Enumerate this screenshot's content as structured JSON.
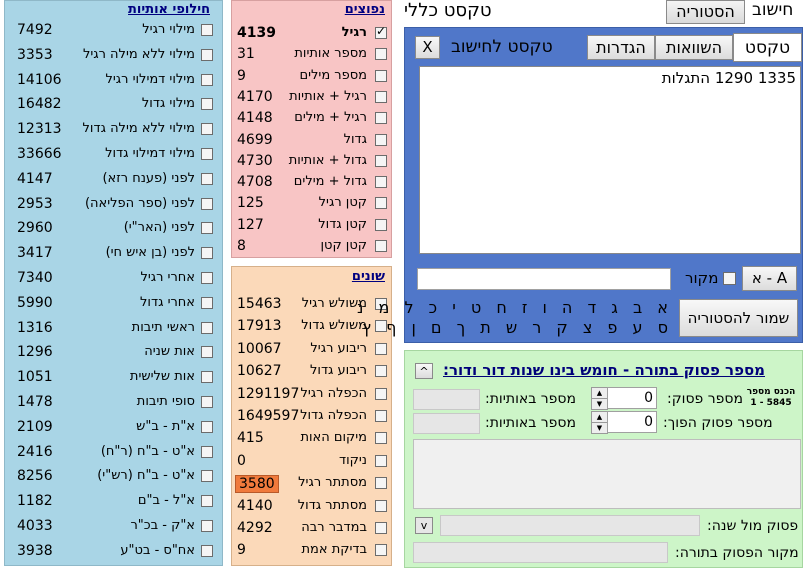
{
  "window": {
    "tab_calc": "חישוב",
    "tab_history": "הסטוריה",
    "general_text": "טקסט כללי"
  },
  "letter_swaps": {
    "title": "חילופי אותיות",
    "rows": [
      {
        "value": "7492",
        "label": "מילוי רגיל"
      },
      {
        "value": "3353",
        "label": "מילוי ללא מילה רגיל"
      },
      {
        "value": "14106",
        "label": "מילוי דמילוי רגיל"
      },
      {
        "value": "16482",
        "label": "מילוי גדול"
      },
      {
        "value": "12313",
        "label": "מילוי ללא מילה גדול"
      },
      {
        "value": "33666",
        "label": "מילוי דמילוי גדול"
      },
      {
        "value": "4147",
        "label": "לפני (פענח רזא)"
      },
      {
        "value": "2953",
        "label": "לפני (ספר הפליאה)"
      },
      {
        "value": "2960",
        "label": "לפני (האר\"י)"
      },
      {
        "value": "3417",
        "label": "לפני (בן איש חי)"
      },
      {
        "value": "7340",
        "label": "אחרי רגיל"
      },
      {
        "value": "5990",
        "label": "אחרי גדול"
      },
      {
        "value": "1316",
        "label": "ראשי תיבות"
      },
      {
        "value": "1296",
        "label": "אות שניה"
      },
      {
        "value": "1051",
        "label": "אות שלישית"
      },
      {
        "value": "1478",
        "label": "סופי תיבות"
      },
      {
        "value": "2109",
        "label": "א\"ת - ב\"ש"
      },
      {
        "value": "2416",
        "label": "א\"ט - ב\"ח (ר\"ח)"
      },
      {
        "value": "8256",
        "label": "א\"ט - ב\"ח (רש\"י)"
      },
      {
        "value": "1182",
        "label": "א\"ל - ב\"ם"
      },
      {
        "value": "4033",
        "label": "א\"ק - בכ\"ר"
      },
      {
        "value": "3938",
        "label": "אח\"ס - בט\"ע"
      }
    ]
  },
  "common": {
    "title": "נפוצים",
    "rows": [
      {
        "value": "4139",
        "label": "רגיל",
        "checked": true
      },
      {
        "value": "31",
        "label": "מספר אותיות"
      },
      {
        "value": "9",
        "label": "מספר מילים"
      },
      {
        "value": "4170",
        "label": "רגיל + אותיות"
      },
      {
        "value": "4148",
        "label": "רגיל + מילים"
      },
      {
        "value": "4699",
        "label": "גדול"
      },
      {
        "value": "4730",
        "label": "גדול + אותיות"
      },
      {
        "value": "4708",
        "label": "גדול + מילים"
      },
      {
        "value": "125",
        "label": "קטן רגיל"
      },
      {
        "value": "127",
        "label": "קטן גדול"
      },
      {
        "value": "8",
        "label": "קטן קטן"
      }
    ]
  },
  "misc": {
    "title": "שונים",
    "rows": [
      {
        "value": "15463",
        "label": "משולש רגיל"
      },
      {
        "value": "17913",
        "label": "משולש גדול"
      },
      {
        "value": "10067",
        "label": "ריבוע רגיל"
      },
      {
        "value": "10627",
        "label": "ריבוע גדול"
      },
      {
        "value": "1291197",
        "label": "הכפלה רגיל"
      },
      {
        "value": "1649597",
        "label": "הכפלה גדול"
      },
      {
        "value": "415",
        "label": "מיקום האות"
      },
      {
        "value": "0",
        "label": "ניקוד"
      },
      {
        "value": "3580",
        "label": "מסתתר רגיל",
        "highlight": "#f07a3c"
      },
      {
        "value": "4140",
        "label": "מסתתר גדול"
      },
      {
        "value": "4292",
        "label": "במדבר רבה"
      },
      {
        "value": "9",
        "label": "בדיקת אמת"
      }
    ]
  },
  "calc_panel": {
    "tabs": [
      "טקסט",
      "השוואות",
      "הגדרות"
    ],
    "text_label": "טקסט לחישוב",
    "close_label": "X",
    "text_value": "1335  1290  התגלות",
    "source_label": "מקור",
    "source_value": "",
    "aleph_bet_button": "א - A",
    "save_history_button": "שמור להסטוריה",
    "letters_row1": "א ב ג ד ה ו ז ח ט י כ ל מ נ",
    "letters_row2": "ס ע פ צ ק ר ש ת ך ם ן ף ץ"
  },
  "verse_panel": {
    "title": "מספר פסוק בתורה - חומש בינו שנות דור ודור:",
    "collapse_icon": "^",
    "enter_hint_line1": "הכנס מספר",
    "enter_hint_line2": "1 - 5845",
    "verse_number_label": "מספר פסוק:",
    "verse_number_value": "0",
    "reverse_verse_label": "מספר פסוק הפוך:",
    "reverse_verse_value": "0",
    "letters_label_1": "מספר באותיות:",
    "letters_value_1": "",
    "letters_label_2": "מספר באותיות:",
    "letters_value_2": "",
    "verse_vs_year_label": "פסוק מול שנה:",
    "verse_vs_year_value": "",
    "verse_source_label": "מקור הפסוק בתורה:",
    "verse_source_value": "",
    "dropdown_icon": "v"
  },
  "colors": {
    "blue_panel": "#a9d5e6",
    "pink_panel": "#f8c5c5",
    "peach_panel": "#fbd9b9",
    "calc_panel": "#5077c9",
    "green_panel": "#cdf5c8",
    "highlight": "#f07a3c"
  }
}
